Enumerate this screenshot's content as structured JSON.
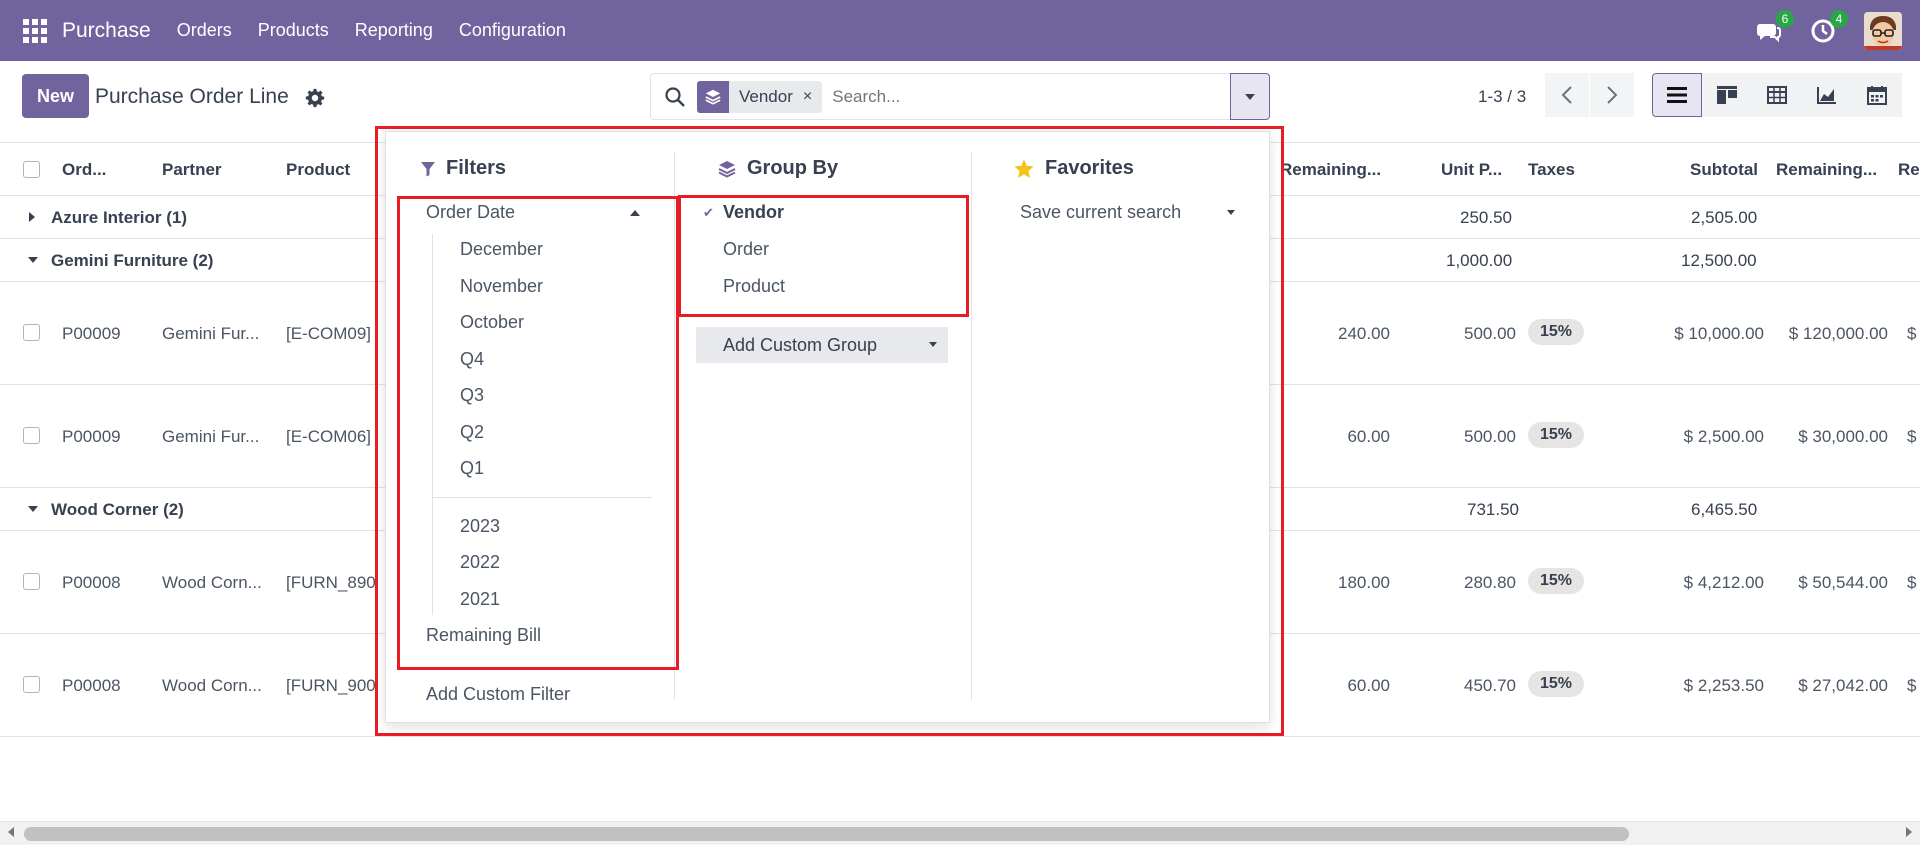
{
  "navbar": {
    "app_name": "Purchase",
    "menu": [
      "Orders",
      "Products",
      "Reporting",
      "Configuration"
    ],
    "messages_count": "6",
    "activities_count": "4",
    "colors": {
      "brand": "#71639e",
      "badge": "#28a745"
    }
  },
  "control_panel": {
    "new_label": "New",
    "title": "Purchase Order Line",
    "search": {
      "facet_label": "Vendor",
      "facet_close": "×",
      "placeholder": "Search..."
    },
    "pager": "1-3 / 3"
  },
  "list": {
    "headers": [
      "Ord...",
      "Partner",
      "Product",
      "Remaining...",
      "Unit P...",
      "Taxes",
      "Subtotal",
      "Remaining...",
      "Re"
    ],
    "groups": [
      {
        "name": "Azure Interior (1)",
        "unit_price": "250.50",
        "subtotal": "2,505.00"
      },
      {
        "name": "Gemini Furniture (2)",
        "unit_price": "1,000.00",
        "subtotal": "12,500.00"
      },
      {
        "name": "Wood Corner (2)",
        "unit_price": "731.50",
        "subtotal": "6,465.50"
      }
    ],
    "rows": [
      {
        "order": "P00009",
        "partner": "Gemini Fur...",
        "product": "[E-COM09]",
        "remaining": "240.00",
        "unit_price": "500.00",
        "tax": "15%",
        "subtotal": "$ 10,000.00",
        "remaining_amount": "$ 120,000.00",
        "extra": "$"
      },
      {
        "order": "P00009",
        "partner": "Gemini Fur...",
        "product": "[E-COM06]",
        "remaining": "60.00",
        "unit_price": "500.00",
        "tax": "15%",
        "subtotal": "$ 2,500.00",
        "remaining_amount": "$ 30,000.00",
        "extra": "$"
      },
      {
        "order": "P00008",
        "partner": "Wood Corn...",
        "product": "[FURN_890",
        "remaining": "180.00",
        "unit_price": "280.80",
        "tax": "15%",
        "subtotal": "$ 4,212.00",
        "remaining_amount": "$ 50,544.00",
        "extra": "$"
      },
      {
        "order": "P00008",
        "partner": "Wood Corn...",
        "product": "[FURN_900",
        "remaining": "60.00",
        "unit_price": "450.70",
        "tax": "15%",
        "subtotal": "$ 2,253.50",
        "remaining_amount": "$ 27,042.00",
        "extra": "$"
      }
    ]
  },
  "search_panel": {
    "filters": {
      "title": "Filters",
      "order_date": "Order Date",
      "months": [
        "December",
        "November",
        "October"
      ],
      "quarters": [
        "Q4",
        "Q3",
        "Q2",
        "Q1"
      ],
      "years": [
        "2023",
        "2022",
        "2021"
      ],
      "remaining_bill": "Remaining Bill",
      "add_custom": "Add Custom Filter"
    },
    "group_by": {
      "title": "Group By",
      "items": [
        "Vendor",
        "Order",
        "Product"
      ],
      "selected_mark": "✔",
      "add_custom": "Add Custom Group"
    },
    "favorites": {
      "title": "Favorites",
      "save": "Save current search"
    },
    "highlight_color": "#e81c24",
    "star_color": "#f3c316"
  }
}
